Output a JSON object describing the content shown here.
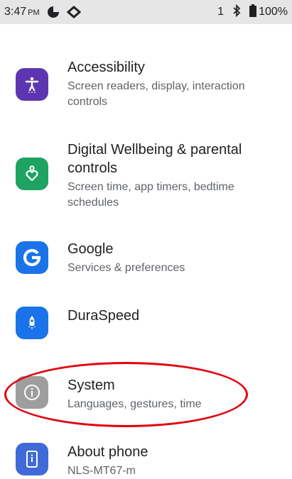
{
  "status_bar": {
    "time": "3:47",
    "ampm": "PM",
    "sim_slot": "1",
    "battery": "100%"
  },
  "settings": {
    "items": [
      {
        "title": "Accessibility",
        "summary": "Screen readers, display, interaction controls",
        "icon": "accessibility-icon",
        "color": "#5e35b1"
      },
      {
        "title": "Digital Wellbeing & parental controls",
        "summary": "Screen time, app timers, bedtime schedules",
        "icon": "wellbeing-heart-icon",
        "color": "#1ea362"
      },
      {
        "title": "Google",
        "summary": "Services & preferences",
        "icon": "google-icon",
        "color": "#1a73e8"
      },
      {
        "title": "DuraSpeed",
        "summary": "",
        "icon": "rocket-icon",
        "color": "#1a73e8"
      },
      {
        "title": "System",
        "summary": "Languages, gestures, time",
        "icon": "info-icon",
        "color": "#9e9e9e"
      },
      {
        "title": "About phone",
        "summary": "NLS-MT67-m",
        "icon": "phone-icon",
        "color": "#3f6ad8"
      }
    ]
  },
  "annotation": {
    "color": "#e3000f"
  }
}
